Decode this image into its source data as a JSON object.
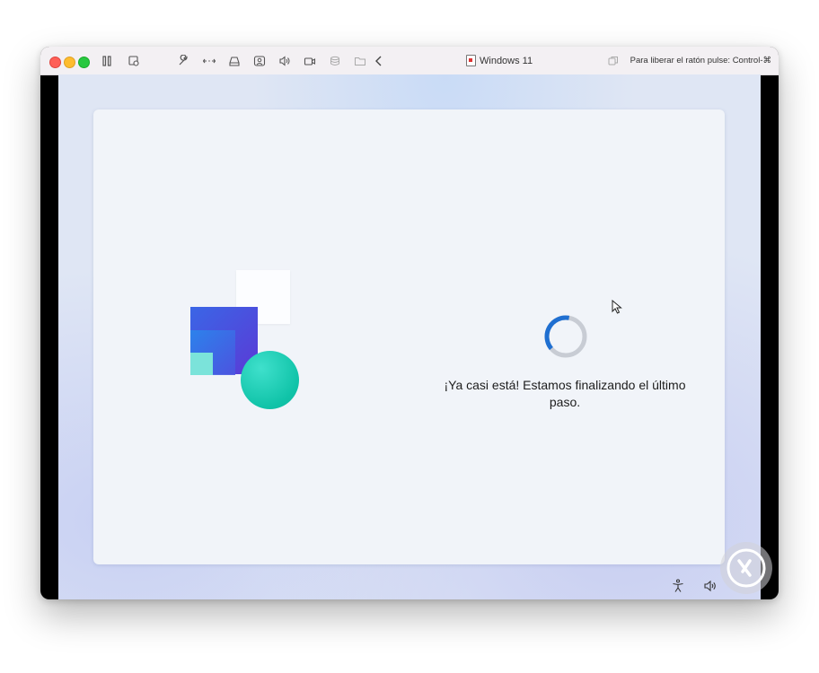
{
  "window": {
    "title": "Windows 11",
    "release_hint": "Para liberar el ratón pulse: Control-⌘"
  },
  "toolbar": {
    "icons": [
      "pause-icon",
      "snapshot-icon",
      "wrench-icon",
      "network-arrows-icon",
      "drive-icon",
      "user-sharing-icon",
      "speaker-icon",
      "camera-icon",
      "storage-icon",
      "folder-icon",
      "chevron-left-icon",
      "window-copy-icon"
    ]
  },
  "setup": {
    "message": "¡Ya casi está! Estamos finalizando el último paso."
  },
  "tray": {
    "icons": [
      "accessibility-icon",
      "volume-icon"
    ]
  },
  "colors": {
    "spinner": "#1f6fd1",
    "accent_blue": "#3a66e6",
    "teal": "#10c3a8"
  }
}
